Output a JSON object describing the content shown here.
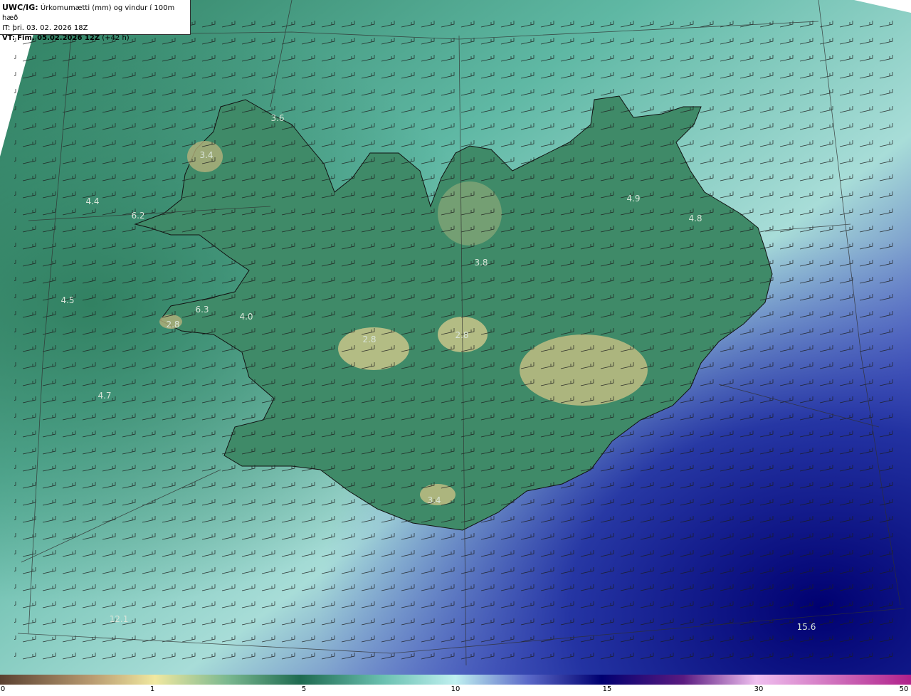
{
  "header": {
    "model": "UWC/IG:",
    "title": "Úrkomumætti (mm) og vindur í 100m hæð",
    "it_line": "IT: þri. 03. 02. 2026 18Z",
    "vt_prefix": "VT:",
    "vt_value": "Fim. 05.02.2026 12Z",
    "vt_suffix": "(+42 h)"
  },
  "map_labels": [
    "4.4",
    "6.2",
    "3.4",
    "4.5",
    "6.3",
    "4.0",
    "2.8",
    "2.8",
    "2.8",
    "3.8",
    "4.9",
    "4.8",
    "4.7",
    "3.4",
    "12.1",
    "15.6",
    "3.6"
  ],
  "colorbar": {
    "ticks": [
      "0",
      "1",
      "5",
      "10",
      "15",
      "30",
      "50"
    ],
    "colors": [
      "#6a4e3a",
      "#c8b080",
      "#f0e8a0",
      "#2e7b60",
      "#a8e8e0",
      "#2a2aa0",
      "#000070",
      "#6a2a8a",
      "#f0b0e8",
      "#b0208a"
    ]
  },
  "colors": {
    "land_green": "#3a8a6a",
    "sea_teal": "#5ab8a0",
    "heavy_precip": "#000080"
  }
}
